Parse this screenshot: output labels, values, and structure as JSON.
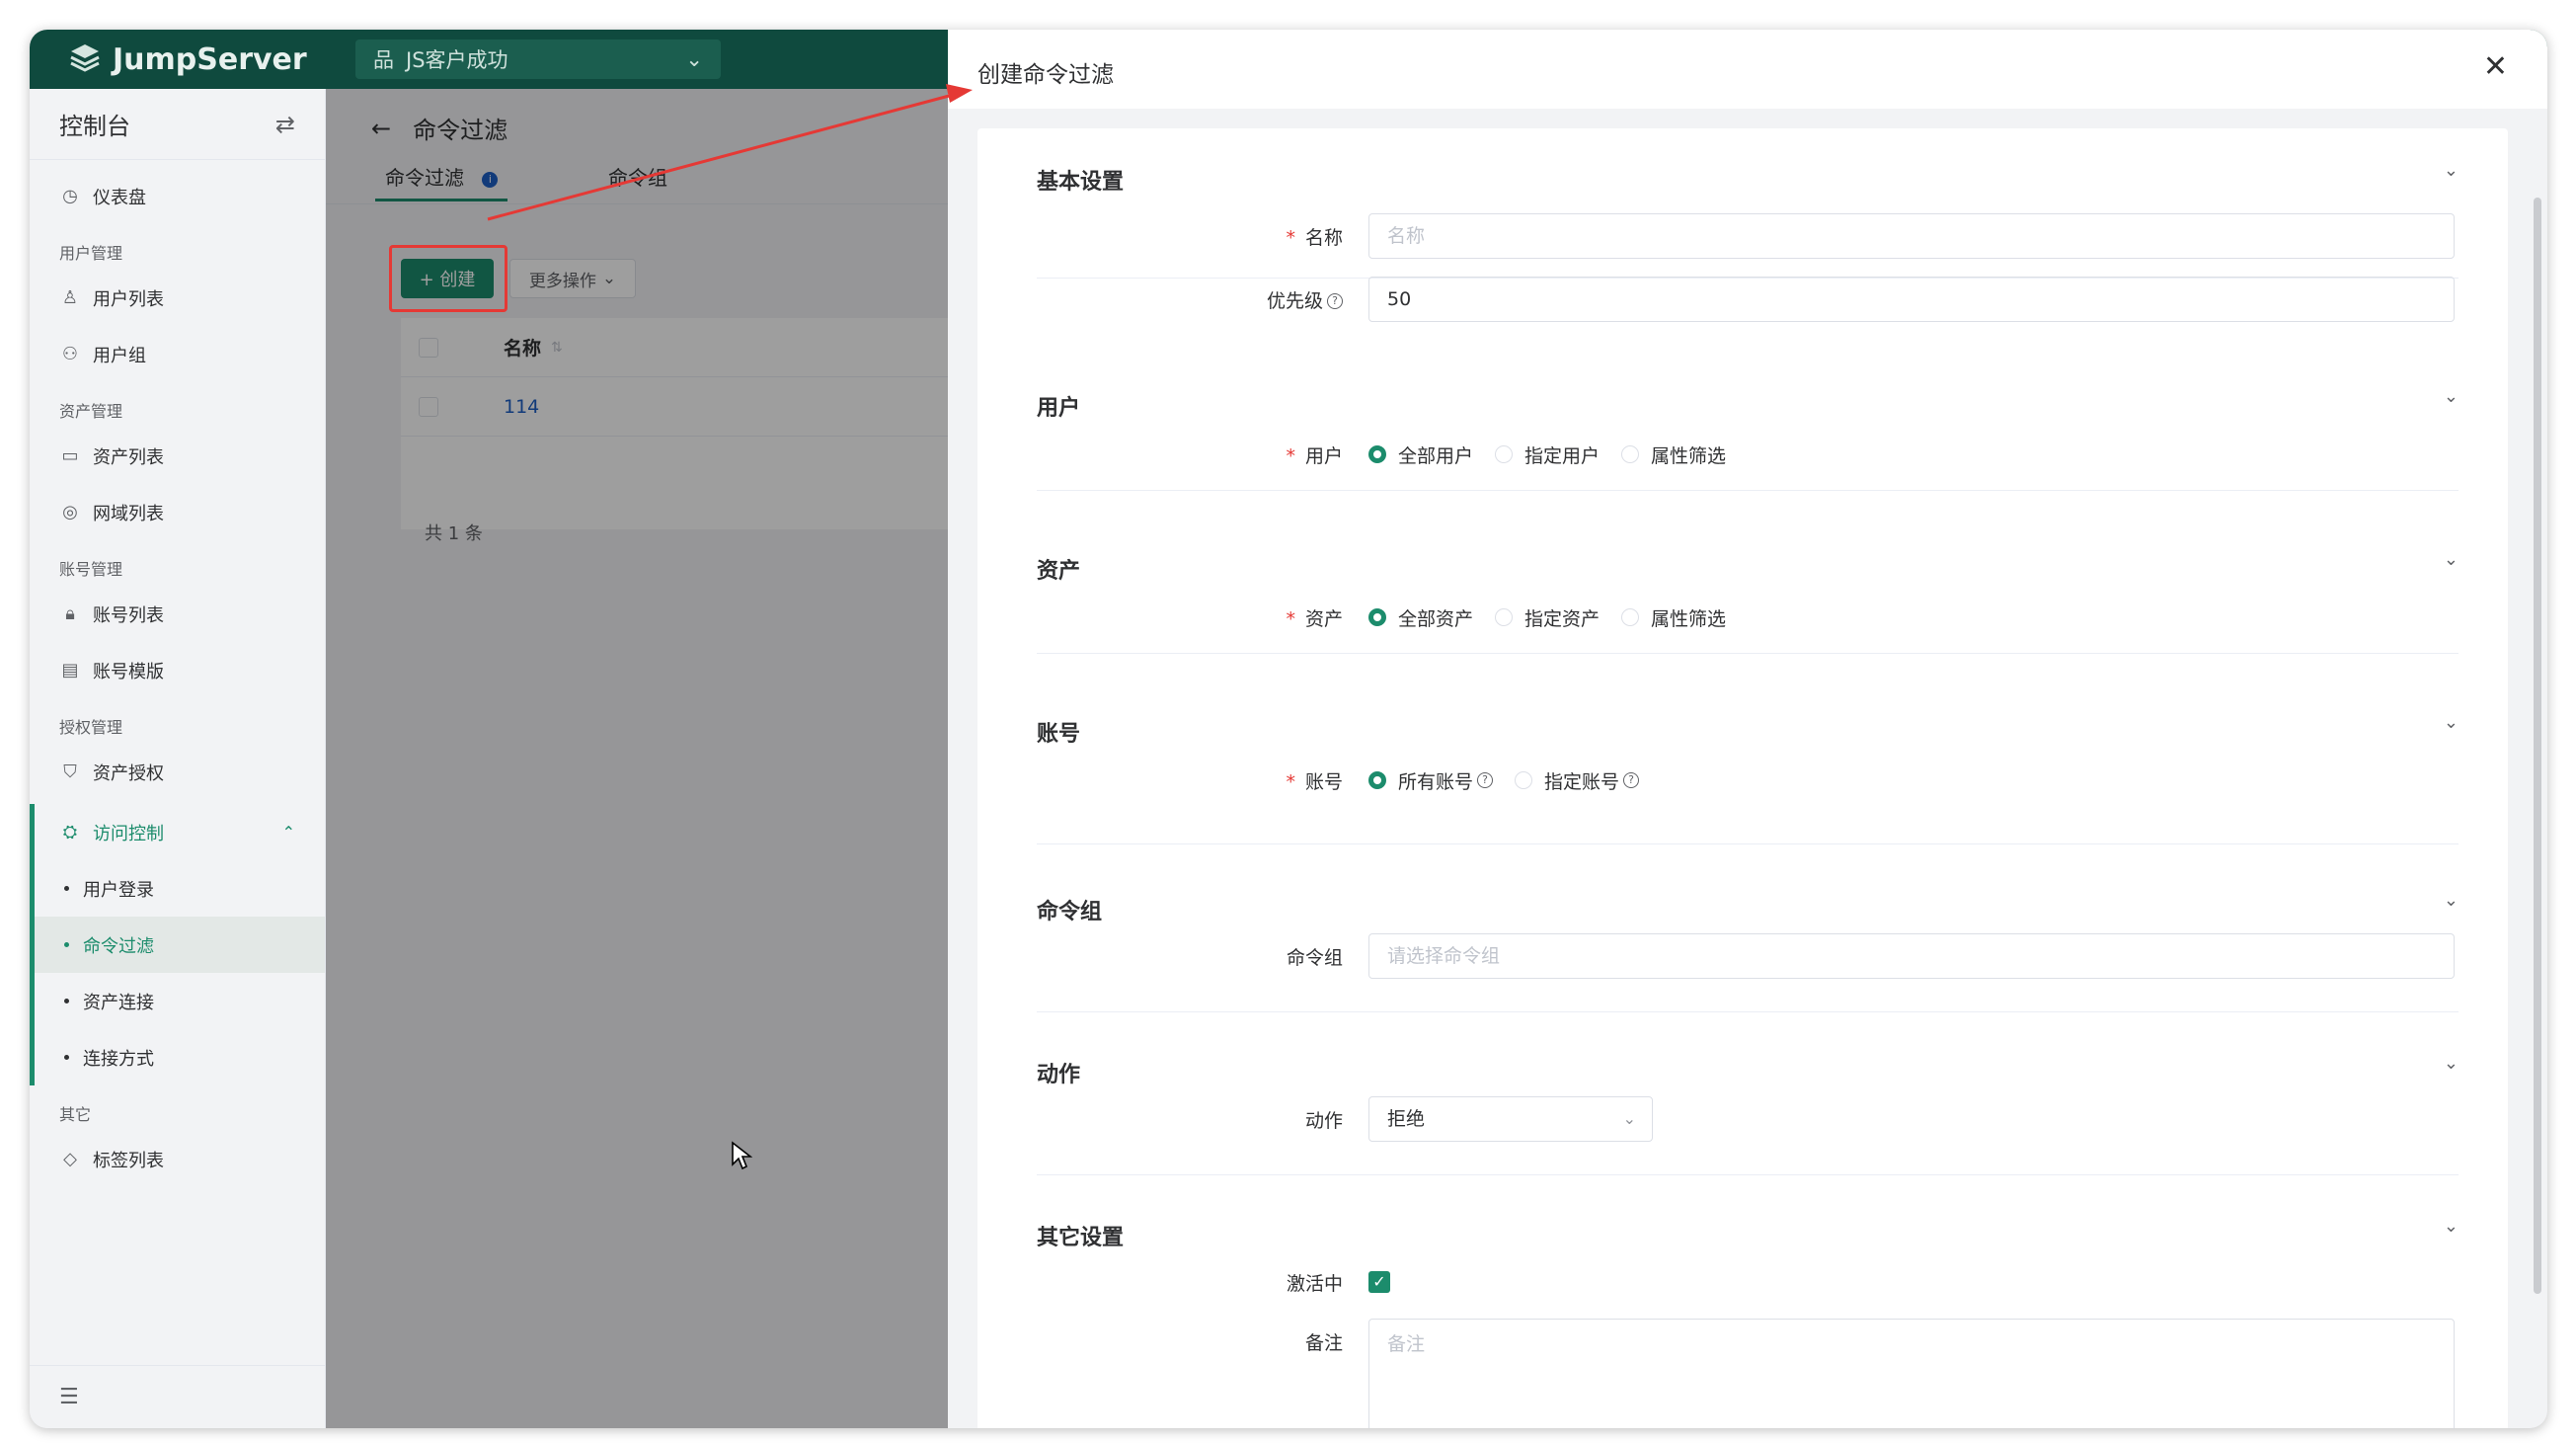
{
  "topbar": {
    "brand": "JumpServer",
    "org": "JS客户成功"
  },
  "sidebar": {
    "title": "控制台",
    "groups": [
      {
        "title": "",
        "items": [
          "仪表盘"
        ]
      },
      {
        "title": "用户管理",
        "items": [
          "用户列表",
          "用户组"
        ]
      },
      {
        "title": "资产管理",
        "items": [
          "资产列表",
          "网域列表"
        ]
      },
      {
        "title": "账号管理",
        "items": [
          "账号列表",
          "账号模版"
        ]
      },
      {
        "title": "授权管理",
        "items": [
          "资产授权"
        ]
      }
    ],
    "access_control": {
      "label": "访问控制",
      "children": [
        "用户登录",
        "命令过滤",
        "资产连接",
        "连接方式"
      ]
    },
    "other": {
      "title": "其它",
      "items": [
        "标签列表"
      ]
    }
  },
  "page": {
    "title": "命令过滤",
    "tabs": [
      "命令过滤",
      "命令组"
    ],
    "create_label": "+ 创建",
    "more_label": "更多操作",
    "table": {
      "header": "名称",
      "rows": [
        "114"
      ]
    },
    "total": "共 1 条"
  },
  "drawer": {
    "title": "创建命令过滤",
    "basic": {
      "title": "基本设置",
      "name_label": "名称",
      "name_placeholder": "名称",
      "priority_label": "优先级",
      "priority_value": "50"
    },
    "users": {
      "title": "用户",
      "label": "用户",
      "options": [
        "全部用户",
        "指定用户",
        "属性筛选"
      ]
    },
    "assets": {
      "title": "资产",
      "label": "资产",
      "options": [
        "全部资产",
        "指定资产",
        "属性筛选"
      ]
    },
    "accounts": {
      "title": "账号",
      "label": "账号",
      "options": [
        "所有账号",
        "指定账号"
      ]
    },
    "command_group": {
      "title": "命令组",
      "label": "命令组",
      "placeholder": "请选择命令组"
    },
    "action": {
      "title": "动作",
      "label": "动作",
      "value": "拒绝"
    },
    "other": {
      "title": "其它设置",
      "active_label": "激活中",
      "comment_label": "备注",
      "comment_placeholder": "备注"
    }
  },
  "colors": {
    "accent": "#1c8c6c",
    "topbar": "#0f4a3e",
    "annotation": "#e53935"
  }
}
